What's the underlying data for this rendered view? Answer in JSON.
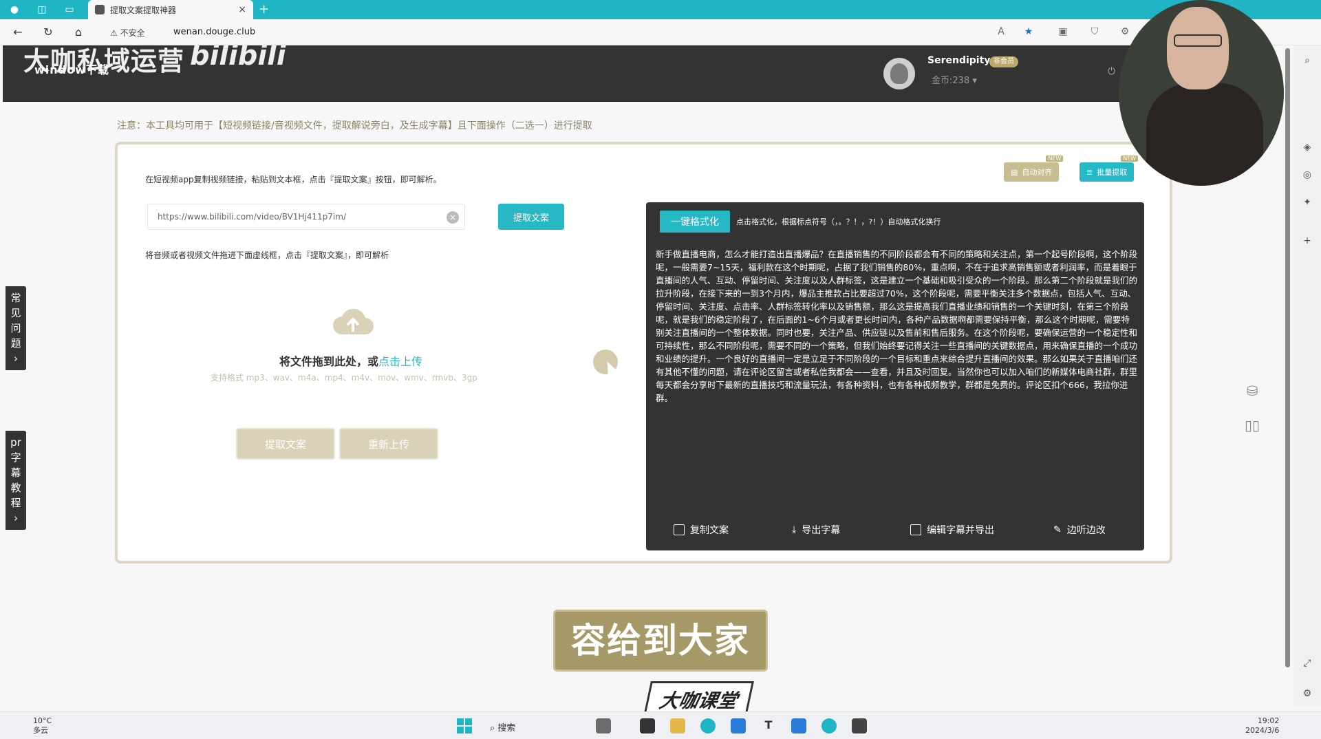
{
  "browser": {
    "tab_title": "提取文案提取神器",
    "tab_close": "×",
    "new_tab": "+",
    "security_label": "不安全",
    "url": "wenan.douge.club"
  },
  "header": {
    "logo_text": "大咖私域运营",
    "logo_bili": "bilibili",
    "logo_sub": "window下载",
    "username": "Serendipity",
    "vip_badge": "非会员",
    "coins": "金币:238 ▾"
  },
  "notice": "注意：本工具均可用于【短视频链接/音视频文件，提取解说旁白，及生成字幕】且下面操作（二选一）进行提取",
  "left": {
    "hint_link": "在短视频app复制视频链接，粘贴到文本框，点击『提取文案』按钮，即可解析。",
    "url_value": "https://www.bilibili.com/video/BV1Hj411p7im/",
    "extract_label": "提取文案",
    "hint_file": "将音频或者视频文件拖进下面虚线框，点击『提取文案』，即可解析",
    "drop_text": "将文件拖到此处，或",
    "drop_link": "点击上传",
    "formats": "支持格式 mp3、wav、m4a、mp4、m4v、mov、wmv、rmvb、3gp",
    "btn_extract": "提取文案",
    "btn_reupload": "重新上传"
  },
  "badges": {
    "auto_label": "自动对齐",
    "batch_label": "批量提取",
    "new_tag": "NEW"
  },
  "result": {
    "format_label": "一键格式化",
    "format_hint": "点击格式化，根据标点符号（，。？！，?！）自动格式化换行",
    "text": "新手做直播电商，怎么才能打造出直播爆品？在直播销售的不同阶段都会有不同的策略和关注点，第一个起号阶段啊，这个阶段呢，一般需要7~15天，福利款在这个时期呢，占据了我们销售的80%，重点啊，不在于追求高销售额或者利润率，而是着眼于直播间的人气、互动、停留时间、关注度以及人群标签，这是建立一个基础和吸引受众的一个阶段。那么第二个阶段就是我们的拉升阶段，在接下来的一到3个月内，爆品主推款占比要超过70%，这个阶段呢，需要平衡关注多个数据点，包括人气、互动、停留时间、关注度、点击率、人群标签转化率以及销售额，那么这是提高我们直播业绩和销售的一个关键时刻，在第三个阶段呢，就是我们的稳定阶段了，在后面的1~6个月或者更长时间内，各种产品数据啊都需要保持平衡，那么这个时期呢，需要特别关注直播间的一个整体数据。同时也要，关注产品、供应链以及售前和售后服务。在这个阶段呢，要确保运营的一个稳定性和可持续性，那么不同阶段呢，需要不同的一个策略，但我们始终要记得关注一些直播间的关键数据点，用来确保直播的一个成功和业绩的提升。一个良好的直播间一定是立足于不同阶段的一个目标和重点来综合提升直播间的效果。那么如果关于直播咱们还有其他不懂的问题，请在评论区留言或者私信我都会——查看，并且及时回复。当然你也可以加入咱们的新媒体电商社群，群里每天都会分享时下最新的直播技巧和流量玩法，有各种资料，也有各种视频教学，群都是免费的。评论区扣个666，我拉你进群。",
    "actions": {
      "copy": "复制文案",
      "export": "导出字幕",
      "edit_export": "编辑字幕并导出",
      "listen_edit": "边听边改"
    }
  },
  "side_tabs": {
    "faq": "常见问题",
    "faq_arrow": "›",
    "pr": "pr字幕教程",
    "pr_arrow": "›"
  },
  "subtitle": "容给到大家",
  "brand": "大咖课堂",
  "taskbar": {
    "temp": "10°C",
    "weather": "多云",
    "search": "搜索",
    "time": "19:02",
    "date": "2024/3/6"
  }
}
